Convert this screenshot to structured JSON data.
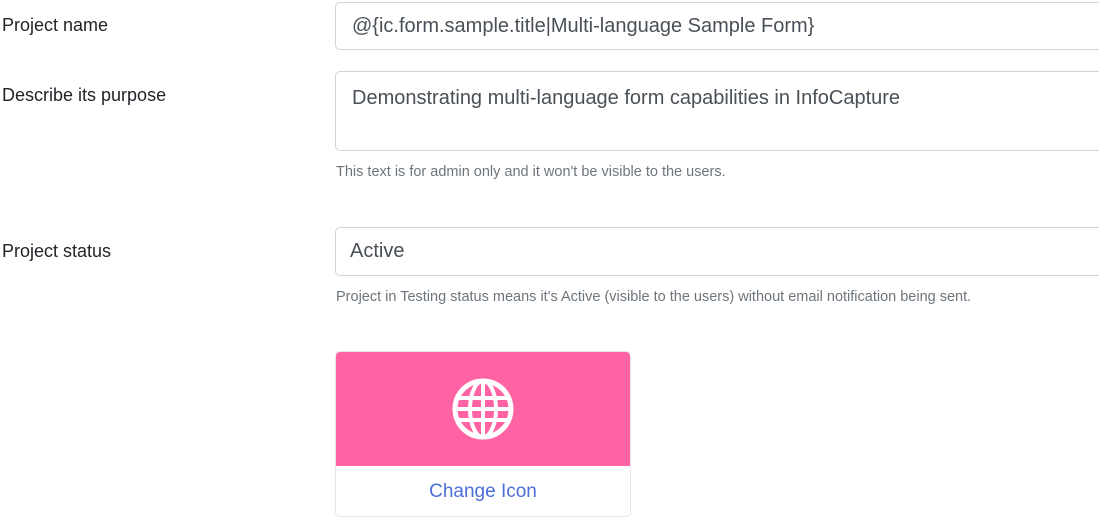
{
  "form": {
    "project_name": {
      "label": "Project name",
      "value": "@{ic.form.sample.title|Multi-language Sample Form}"
    },
    "purpose": {
      "label": "Describe its purpose",
      "value": "Demonstrating multi-language form capabilities in InfoCapture",
      "help": "This text is for admin only and it won't be visible to the users."
    },
    "status": {
      "label": "Project status",
      "value": "Active",
      "help": "Project in Testing status means it's Active (visible to the users) without email notification being sent."
    },
    "icon": {
      "icon_name": "globe-icon",
      "background_color": "#ff63a3",
      "change_label": "Change Icon"
    }
  }
}
